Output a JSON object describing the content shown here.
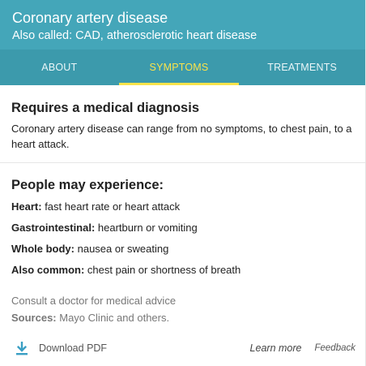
{
  "header": {
    "title": "Coronary artery disease",
    "subtitle": "Also called: CAD, atherosclerotic heart disease"
  },
  "tabs": [
    {
      "label": "ABOUT",
      "active": false
    },
    {
      "label": "SYMPTOMS",
      "active": true
    },
    {
      "label": "TREATMENTS",
      "active": false
    }
  ],
  "diagnosis": {
    "heading": "Requires a medical diagnosis",
    "text": "Coronary artery disease can range from no symptoms, to chest pain, to a heart attack."
  },
  "experience": {
    "heading": "People may experience:",
    "items": [
      {
        "label": "Heart:",
        "value": " fast heart rate or heart attack"
      },
      {
        "label": "Gastrointestinal:",
        "value": " heartburn or vomiting"
      },
      {
        "label": "Whole body:",
        "value": " nausea or sweating"
      },
      {
        "label": "Also common:",
        "value": " chest pain or shortness of breath"
      }
    ]
  },
  "advice": "Consult a doctor for medical advice",
  "sources": {
    "label": "Sources:",
    "value": " Mayo Clinic and others."
  },
  "footer": {
    "download_label": "Download PDF",
    "download_icon": "download-icon",
    "learn_more": "Learn more",
    "feedback": "Feedback"
  },
  "colors": {
    "header_bg": "#44a6b9",
    "tabs_bg": "#3c9aac",
    "active_tab": "#fbe34b",
    "icon": "#3a9fc4"
  }
}
